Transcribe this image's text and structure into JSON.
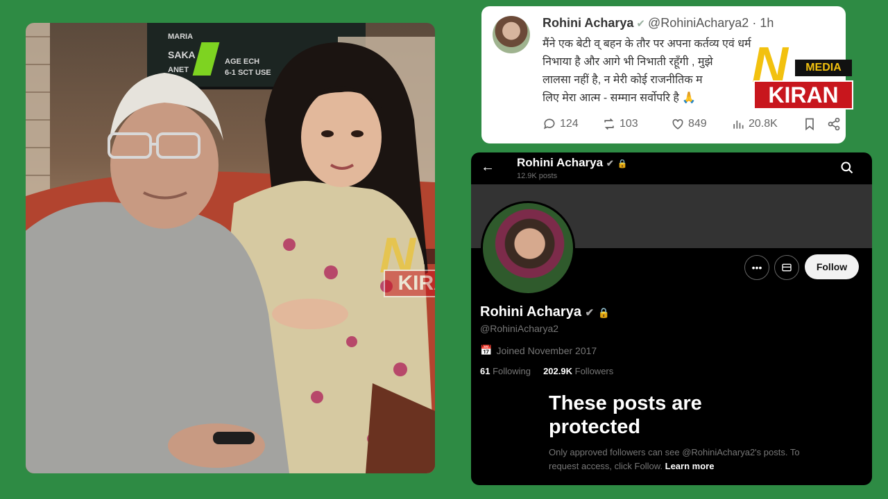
{
  "photo": {
    "tv_lines": [
      "MARIA",
      "SAKA",
      "ANET",
      "AGE ECH",
      "6-1 SCT USE"
    ]
  },
  "watermark": {
    "n": "N",
    "media": "MEDIA",
    "kiran": "KIRAN"
  },
  "tweet": {
    "name": "Rohini Acharya",
    "handle": "@RohiniAcharya2",
    "time": "· 1h",
    "lines": [
      "मैंने एक बेटी व् बहन के तौर पर अपना कर्तव्य एवं धर्म",
      "निभाया है और आगे भी निभाती रहूँगी , मुझे",
      "लालसा नहीं है, न मेरी कोई राजनीतिक म",
      "लिए मेरा आत्म - सम्मान सर्वोपरि है 🙏"
    ],
    "replies": "124",
    "reposts": "103",
    "likes": "849",
    "views": "20.8K"
  },
  "profile": {
    "top_name": "Rohini Acharya",
    "post_count": "12.9K posts",
    "name": "Rohini Acharya",
    "handle": "@RohiniAcharya2",
    "joined": "Joined November 2017",
    "following_count": "61",
    "following_label": "Following",
    "followers_count": "202.9K",
    "followers_label": "Followers",
    "follow_button": "Follow",
    "protected_title": "These posts are protected",
    "protected_desc": "Only approved followers can see @RohiniAcharya2's posts. To request access, click Follow.",
    "learn_more": "Learn more"
  },
  "colors": {
    "background": "#2e8b44",
    "brand_yellow": "#f2c10f",
    "brand_red": "#c8161d"
  }
}
